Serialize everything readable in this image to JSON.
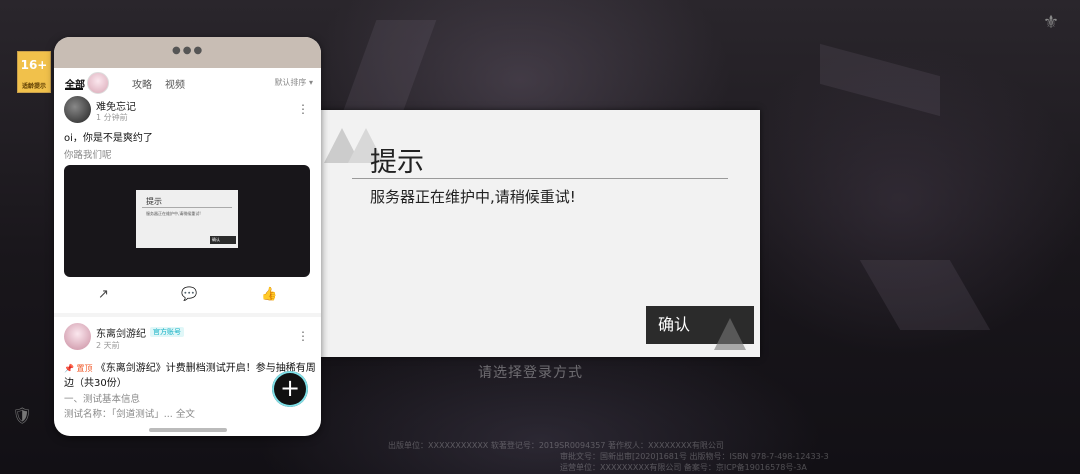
{
  "background": {
    "age_rating": "16+",
    "age_rating_sub": "适龄提示",
    "login_hint": "请选择登录方式",
    "footer_lines": [
      "出版单位：XXXXXXXXXXX  软著登记号：2019SR0094357  著作权人：XXXXXXXX有限公司",
      "审批文号：国新出审[2020]1681号  出版物号：ISBN 978-7-498-12433-3",
      "运营单位：XXXXXXXXX有限公司  备案号：京ICP备19016578号-3A"
    ]
  },
  "dialog": {
    "title": "提示",
    "message": "服务器正在维护中,请稍候重试!",
    "confirm_label": "确认"
  },
  "phone": {
    "tabs": [
      "全部",
      "攻略",
      "视频"
    ],
    "sort_label": "默认排序 ▾",
    "post1": {
      "username": "难免忘记",
      "time": "1 分钟前",
      "text": "oi，你是不是爽约了",
      "subtext": "你路我们呢",
      "image_dialog": {
        "title": "提示",
        "message": "服务器正在维护中,请稍候重试!",
        "button": "确认"
      }
    },
    "post2": {
      "username": "东离剑游纪",
      "badge": "官方账号",
      "time": "2 天前",
      "pin_label": "📌 置顶",
      "title_line1": "《东离剑游纪》计费删档测试开启！参与抽稀有周",
      "title_line2": "边（共30份）",
      "sub1": "一、测试基本信息",
      "sub2": "测试名称：「剑道测试」... 全文"
    },
    "fab_label": "+"
  }
}
